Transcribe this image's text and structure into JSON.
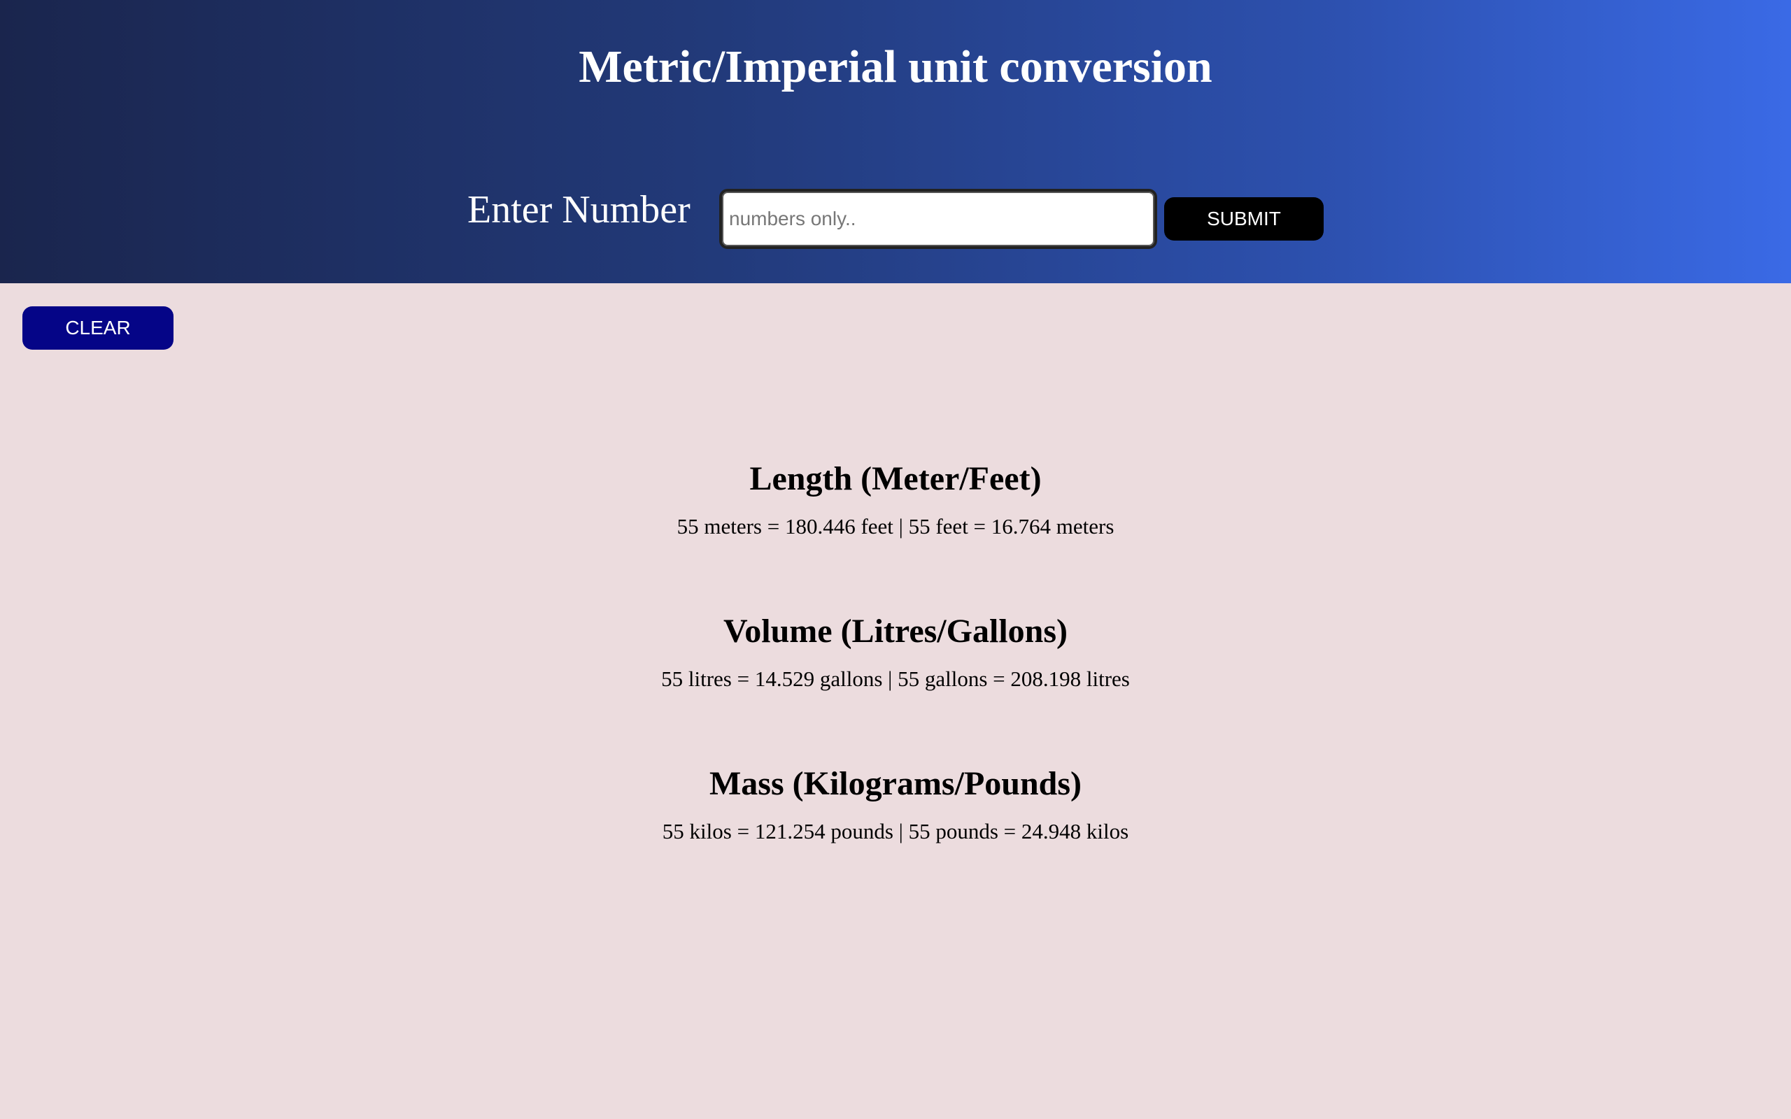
{
  "header": {
    "title": "Metric/Imperial unit conversion",
    "input_label": "Enter Number",
    "input_placeholder": "numbers only..",
    "input_value": "",
    "submit_label": "SUBMIT"
  },
  "clear_label": "CLEAR",
  "results": [
    {
      "title": "Length (Meter/Feet)",
      "text": "55 meters = 180.446 feet | 55 feet = 16.764 meters"
    },
    {
      "title": "Volume (Litres/Gallons)",
      "text": "55 litres = 14.529 gallons | 55 gallons = 208.198 litres"
    },
    {
      "title": "Mass (Kilograms/Pounds)",
      "text": "55 kilos = 121.254 pounds | 55 pounds = 24.948 kilos"
    }
  ],
  "colors": {
    "header_gradient_start": "#1a254d",
    "header_gradient_end": "#3a6ae6",
    "page_background": "#ecdcde",
    "submit_button": "#000000",
    "clear_button": "#050587"
  }
}
